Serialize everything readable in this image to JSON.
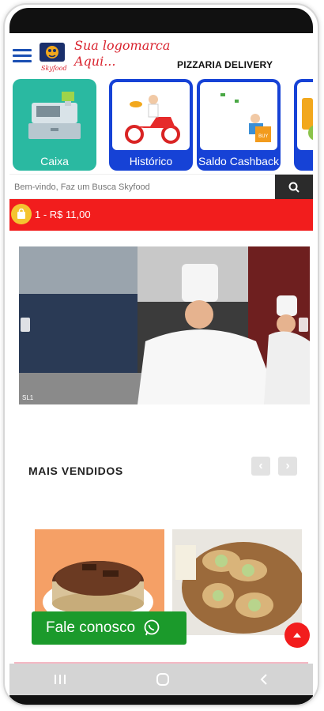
{
  "header": {
    "logo_text_line1": "Sua logomarca",
    "logo_text_line2": "Aqui...",
    "logo_brand": "Skyfood",
    "store_title": "PIZZARIA DELIVERY"
  },
  "categories": [
    {
      "label": "Caixa",
      "bg": "#2ab9a1",
      "icon": "cash-register-icon"
    },
    {
      "label": "Histórico",
      "bg": "#1642d6",
      "icon": "delivery-scooter-icon"
    },
    {
      "label": "Saldo Cashback",
      "bg": "#1642d6",
      "icon": "cashback-icon"
    },
    {
      "label": "",
      "bg": "#1642d6",
      "icon": "food-icon"
    }
  ],
  "search": {
    "placeholder": "Bem-vindo, Faz um Busca Skyfood"
  },
  "cart": {
    "summary": "1 - R$ 11,00"
  },
  "banner": {
    "slide_label": "SL1"
  },
  "section": {
    "title": "MAIS VENDIDOS"
  },
  "whatsapp": {
    "label": "Fale conosco"
  },
  "colors": {
    "accent_red": "#f21d1d",
    "category_blue": "#1642d6",
    "category_teal": "#2ab9a1",
    "whatsapp_green": "#1b9a2b"
  }
}
